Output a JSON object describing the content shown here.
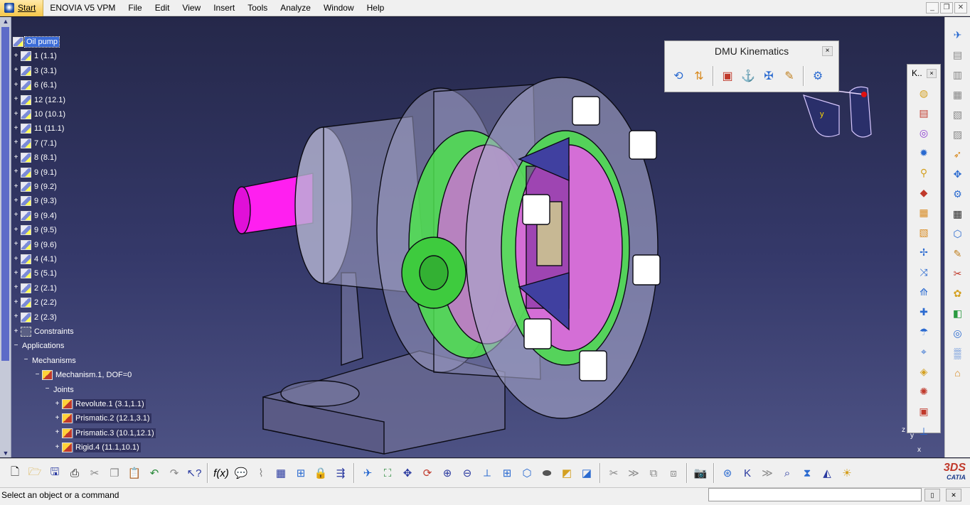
{
  "menubar": {
    "start": "Start",
    "items": [
      "ENOVIA V5 VPM",
      "File",
      "Edit",
      "View",
      "Insert",
      "Tools",
      "Analyze",
      "Window",
      "Help"
    ],
    "window_buttons": [
      "_",
      "❐",
      "✕"
    ]
  },
  "tree": {
    "root": "Oil pump",
    "parts": [
      "1 (1.1)",
      "3 (3.1)",
      "6 (6.1)",
      "12 (12.1)",
      "10 (10.1)",
      "11 (11.1)",
      "7 (7.1)",
      "8 (8.1)",
      "9 (9.1)",
      "9 (9.2)",
      "9 (9.3)",
      "9 (9.4)",
      "9 (9.5)",
      "9 (9.6)",
      "4 (4.1)",
      "5 (5.1)",
      "2 (2.1)",
      "2 (2.2)",
      "2 (2.3)"
    ],
    "constraints": "Constraints",
    "applications": "Applications",
    "mechanisms": "Mechanisms",
    "mechanism": "Mechanism.1, DOF=0",
    "joints": "Joints",
    "joint_items": [
      "Revolute.1 (3.1,1.1)",
      "Prismatic.2 (12.1,3.1)",
      "Prismatic.3 (10.1,12.1)",
      "Rigid.4 (11.1,10.1)"
    ]
  },
  "dmu_toolbar": {
    "title": "DMU Kinematics",
    "close": "×",
    "icons": [
      "simulation-icon",
      "simulation-commands-icon",
      "assembly-constraints-icon",
      "revolute-joint-icon",
      "fixed-part-icon",
      "speed-acceleration-icon",
      "mechanism-analysis-icon"
    ]
  },
  "k_toolbar": {
    "title": "K..",
    "close": "×"
  },
  "compass": {
    "z": "z",
    "y": "y",
    "x": "x"
  },
  "mini_axis": {
    "z": "z",
    "y": "y",
    "x": "x"
  },
  "bottom_logo": "CATIA",
  "statusbar": {
    "message": "Select an object or a command",
    "input_value": ""
  },
  "colors": {
    "viewport_top": "#25284a",
    "viewport_bottom": "#4d5284",
    "shaft": "#ff1ff0",
    "gear_ring": "#4ee24e",
    "housing": "#c9c9e0",
    "selection": "#3b6cd8"
  }
}
